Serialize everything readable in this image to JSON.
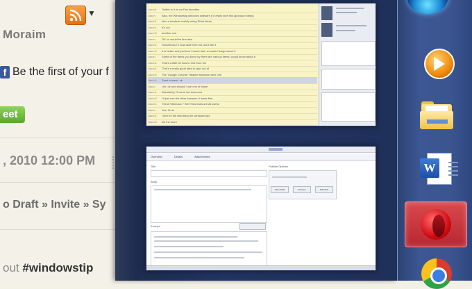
{
  "background_page": {
    "username_partial": "Moraim",
    "fb_icon_label": "f",
    "facebook_text": "Be the first of your f",
    "tweet_label": "eet",
    "date_text": ", 2010 12:00 PM",
    "breadcrumb": "o Draft » Invite » Sy",
    "tag_prefix": "out ",
    "tag_name": "#windowstip",
    "rss_dropdown": "▼"
  },
  "preview_top": {
    "rows": [
      {
        "who": "Jason1",
        "text": "Twitter is it in our Fan favorites"
      },
      {
        "who": "Jason",
        "text": "Also, the Windowstip.windows software (I'd really love this approach ideas)"
      },
      {
        "who": "Jason1",
        "text": "also a windows mainly using Rhub ideas"
      },
      {
        "who": "Jason1",
        "text": "It's not"
      },
      {
        "who": "Jason2",
        "text": "another one"
      },
      {
        "who": "Jason",
        "text": "OK so would be fine also"
      },
      {
        "who": "Jason1",
        "text": "Sometimes I'll read stuff here but don't like it"
      },
      {
        "who": "Jason2",
        "text": "It is better and just how I found that; so useful things about it"
      },
      {
        "who": "Jason",
        "text": "Some of the items you know by there are various items; would know about it"
      },
      {
        "who": "Jason1",
        "text": "That's a little bit how to end from the"
      },
      {
        "who": "Jason1",
        "text": "That's a really good idea to start out at"
      },
      {
        "who": "Jason2",
        "text": "The 'Google Chrome' Header windows have one"
      },
      {
        "who": "Jason1",
        "text": "Send a tweet, ok"
      },
      {
        "who": "Jason",
        "text": "Um, ok and should I use one of those"
      },
      {
        "who": "Jason1",
        "text": "Absolutely, I'll send out tomorrow"
      },
      {
        "who": "Jason2",
        "text": "I'll just use the other browser, it loads fine"
      },
      {
        "who": "Jason1",
        "text": "These Windows 7 Win+Shortcuts are all useful"
      },
      {
        "who": "Jason",
        "text": "Yes, I'll do"
      },
      {
        "who": "Jason1",
        "text": "I feel it's the best thing for windows tips"
      },
      {
        "who": "Jason2",
        "text": "tell the team"
      }
    ]
  },
  "preview_bottom": {
    "tabs": [
      "Overview",
      "Details",
      "Attachments"
    ],
    "form_label_1": "Title",
    "form_label_2": "Body",
    "form_label_3": "Excerpt",
    "sidebar_label": "Publish Options",
    "buttons": [
      "Save Draft",
      "Preview",
      "Schedule"
    ]
  },
  "taskbar": {
    "items": [
      {
        "name": "windows-start",
        "active": false
      },
      {
        "name": "media-player",
        "active": false
      },
      {
        "name": "file-explorer",
        "active": false
      },
      {
        "name": "word",
        "active": false,
        "badge": "W"
      },
      {
        "name": "opera",
        "active": true
      },
      {
        "name": "chrome",
        "active": false
      }
    ]
  },
  "colors": {
    "panel": "#223563",
    "taskbar": "#3a5590",
    "opera_active": "#c62f37",
    "tweet": "#6bb936",
    "facebook": "#3b5998",
    "rss": "#f08a24"
  }
}
